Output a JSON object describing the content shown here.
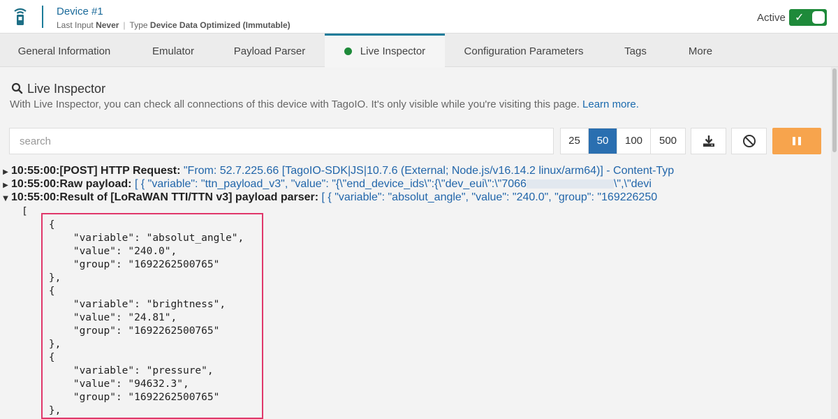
{
  "header": {
    "device_name": "Device #1",
    "last_input_label": "Last Input",
    "last_input_value": "Never",
    "type_label": "Type",
    "type_value": "Device Data Optimized (Immutable)",
    "status_label": "Active",
    "status_on": true
  },
  "tabs": [
    {
      "label": "General Information"
    },
    {
      "label": "Emulator"
    },
    {
      "label": "Payload Parser"
    },
    {
      "label": "Live Inspector",
      "active": true
    },
    {
      "label": "Configuration Parameters"
    },
    {
      "label": "Tags"
    },
    {
      "label": "More"
    }
  ],
  "section": {
    "title": "Live Inspector",
    "description": "With Live Inspector, you can check all connections of this device with TagoIO. It's only visible while you're visiting this page.",
    "learn_more": "Learn more."
  },
  "toolbar": {
    "search_placeholder": "search",
    "counts": [
      "25",
      "50",
      "100",
      "500"
    ],
    "selected_count": "50"
  },
  "logs": [
    {
      "time": "10:55:00:",
      "label": "[POST] HTTP Request:",
      "value": "\"From: 52.7.225.66 [TagoIO-SDK|JS|10.7.6 (External; Node.js/v16.14.2 linux/arm64)] - Content-Typ",
      "expanded": false
    },
    {
      "time": "10:55:00:",
      "label": "Raw payload:",
      "value_a": "[ { \"variable\": \"ttn_payload_v3\", \"value\": \"{\\\"end_device_ids\\\":{\\\"dev_eui\\\":\\\"7066",
      "value_b": "\\\",\\\"devi",
      "expanded": false
    },
    {
      "time": "10:55:00:",
      "label": "Result of [LoRaWAN TTI/TTN v3] payload parser:",
      "value": "[ { \"variable\": \"absolut_angle\", \"value\": \"240.0\", \"group\": \"169226250",
      "expanded": true
    }
  ],
  "json_lines": [
    "[",
    "    {",
    "        \"variable\": \"absolut_angle\",",
    "        \"value\": \"240.0\",",
    "        \"group\": \"1692262500765\"",
    "    },",
    "    {",
    "        \"variable\": \"brightness\",",
    "        \"value\": \"24.81\",",
    "        \"group\": \"1692262500765\"",
    "    },",
    "    {",
    "        \"variable\": \"pressure\",",
    "        \"value\": \"94632.3\",",
    "        \"group\": \"1692262500765\"",
    "    },"
  ],
  "colors": {
    "accent": "#1c7c9a",
    "active_green": "#1e8a3a",
    "selected_blue": "#2a6fb0",
    "pause_orange": "#f7a44d",
    "highlight_pink": "#e0376a"
  }
}
